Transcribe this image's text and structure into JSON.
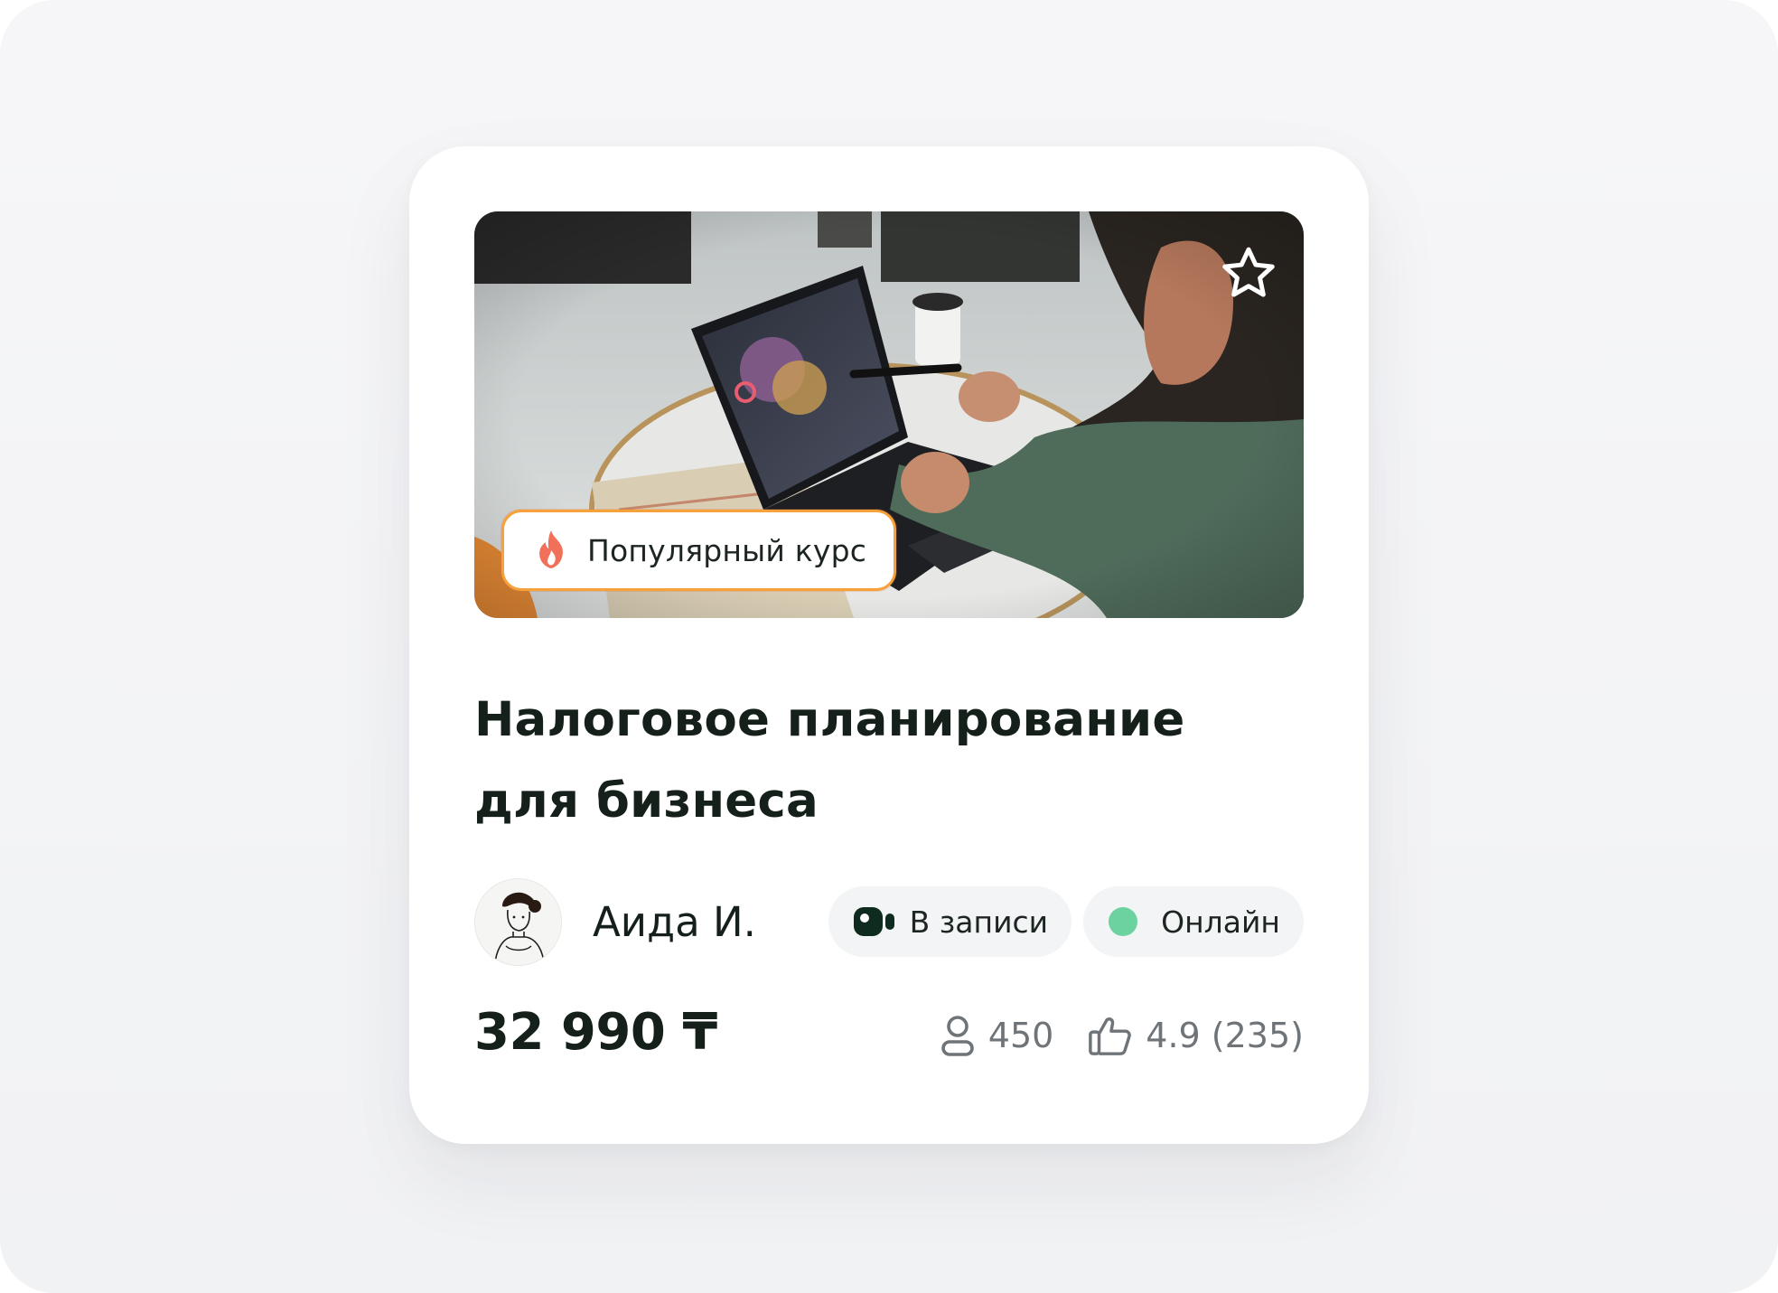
{
  "course": {
    "badge_label": "Популярный курс",
    "title": "Налоговое планирование для бизнеса",
    "author_name": "Аида И.",
    "formats": [
      {
        "label": "В записи",
        "icon": "video-camera-icon"
      },
      {
        "label": "Онлайн",
        "icon": "online-status-dot",
        "color": "#6cd3a0"
      }
    ],
    "price": "32 990 ₸",
    "students_count": "450",
    "rating": "4.9 (235)"
  },
  "icons": {
    "favorite": "star-outline-icon",
    "badge": "flame-icon",
    "students": "user-icon",
    "rating": "thumbs-up-icon"
  },
  "colors": {
    "badge_border": "#f5a23a",
    "flame": "#f0705a",
    "online_dot": "#6cd3a0",
    "text_dark": "#15201b",
    "text_muted": "#6f7479"
  }
}
